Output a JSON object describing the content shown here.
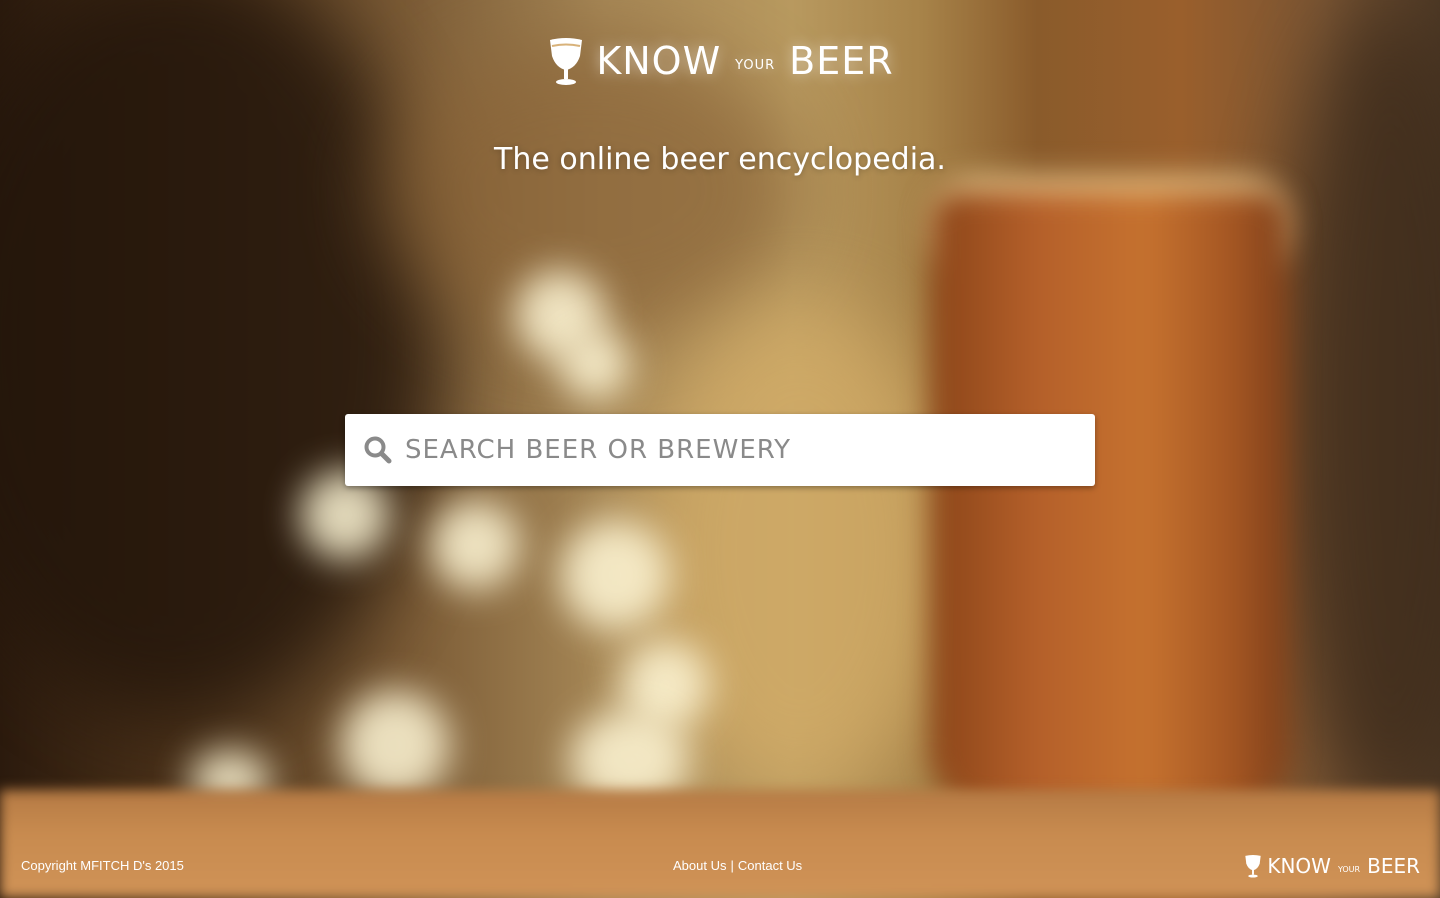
{
  "brand": {
    "word1": "KNOW",
    "word2": "YOUR",
    "word3": "BEER",
    "icon": "beer-glass-icon"
  },
  "tagline": "The online beer encyclopedia.",
  "search": {
    "placeholder": "SEARCH BEER OR BREWERY",
    "value": "",
    "icon": "search-icon"
  },
  "footer": {
    "copyright": "Copyright MFITCH D's 2015",
    "about_label": "About Us",
    "separator": "|",
    "contact_label": "Contact Us"
  },
  "colors": {
    "text": "#ffffff",
    "search_bg": "#ffffff",
    "placeholder": "#8a8a8a"
  }
}
